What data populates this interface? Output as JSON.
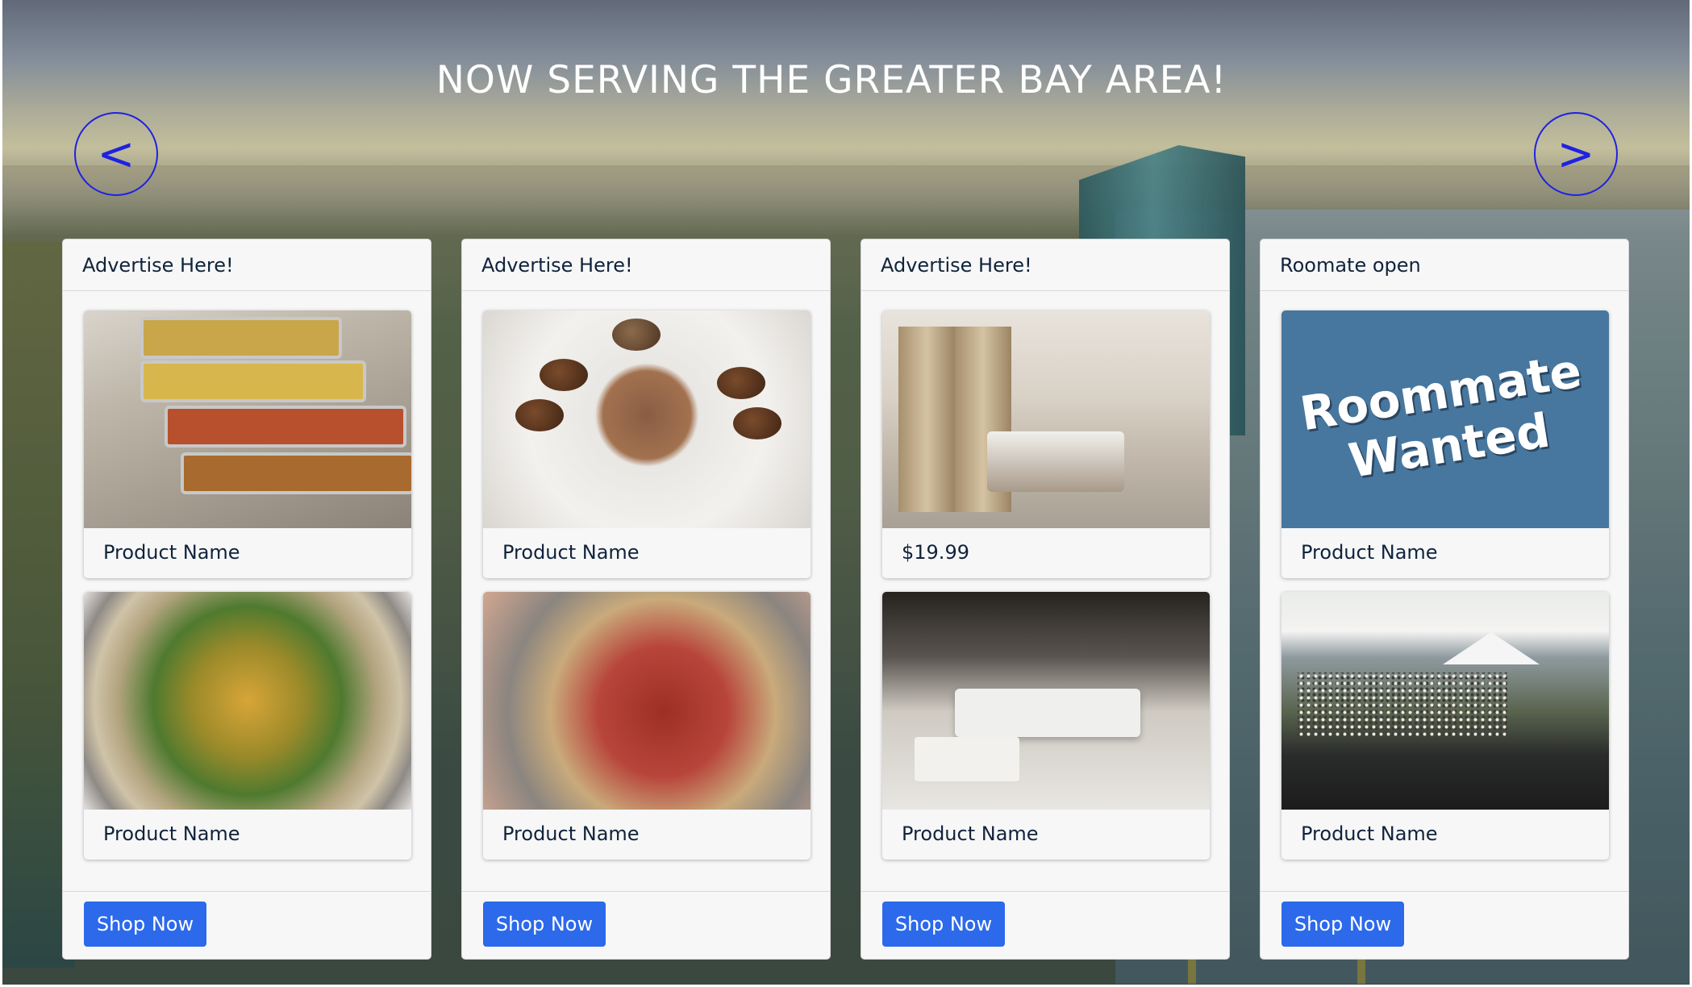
{
  "banner": {
    "title": "NOW SERVING THE GREATER BAY AREA!",
    "prev_label": "<",
    "next_label": ">"
  },
  "colors": {
    "arrow": "#1f22e0",
    "button": "#2c69eb",
    "card_bg": "#f7f7f7",
    "text": "#10233c"
  },
  "cards": [
    {
      "header": "Advertise Here!",
      "products": [
        {
          "label": "Product Name",
          "image": "buffet-trays-photo"
        },
        {
          "label": "Product Name",
          "image": "injera-platter-photo"
        }
      ],
      "button": "Shop Now"
    },
    {
      "header": "Advertise Here!",
      "products": [
        {
          "label": "Product Name",
          "image": "pastry-platter-photo"
        },
        {
          "label": "Product Name",
          "image": "meat-platter-photo"
        }
      ],
      "button": "Shop Now"
    },
    {
      "header": "Advertise Here!",
      "products": [
        {
          "label": "$19.99",
          "image": "bedroom-photo"
        },
        {
          "label": "Product Name",
          "image": "living-room-photo"
        }
      ],
      "button": "Shop Now"
    },
    {
      "header": "Roomate open",
      "products": [
        {
          "label": "Product Name",
          "image": "roommate-wanted-sign",
          "image_text": [
            "Roommate",
            "Wanted"
          ]
        },
        {
          "label": "Product Name",
          "image": "outdoor-concert-photo"
        }
      ],
      "button": "Shop Now"
    }
  ]
}
